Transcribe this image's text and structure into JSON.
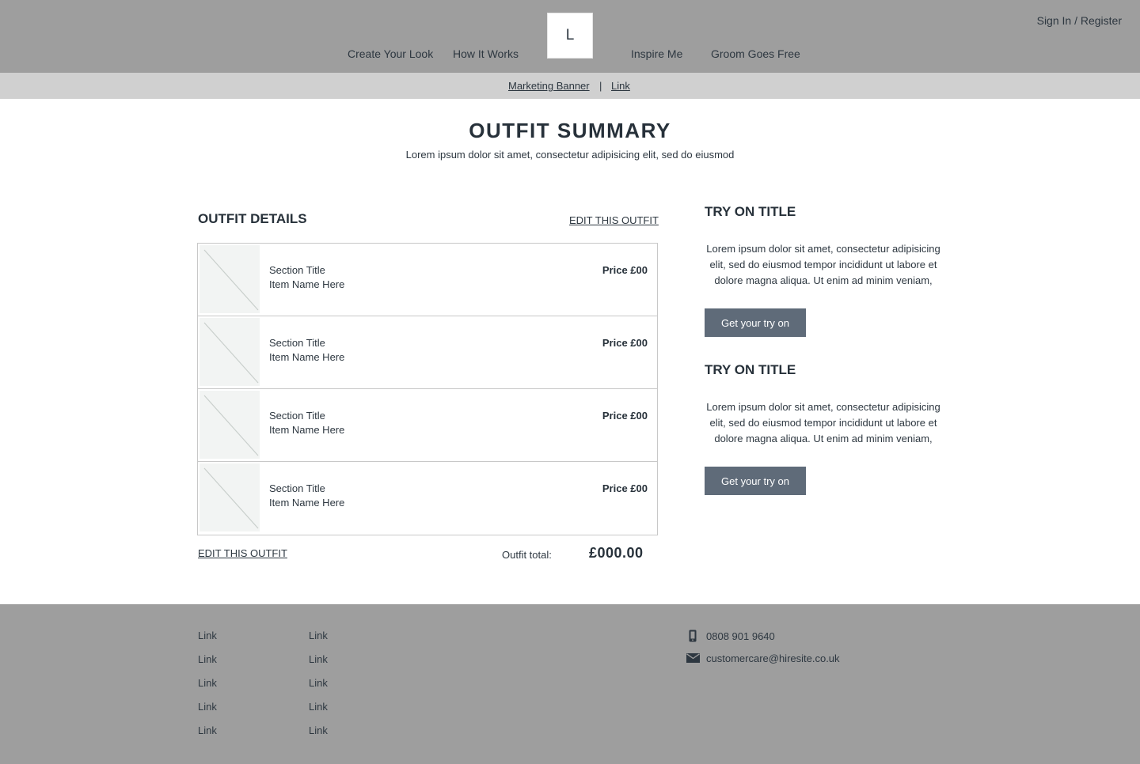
{
  "header": {
    "logo": "L",
    "nav": [
      "Create Your Look",
      "How It Works",
      "Inspire Me",
      "Groom Goes Free"
    ],
    "signin": "Sign In / Register"
  },
  "banner": {
    "text": "Marketing Banner",
    "separator": "|",
    "link": "Link"
  },
  "main": {
    "title": "OUTFIT SUMMARY",
    "subtitle": "Lorem ipsum dolor sit amet, consectetur adipisicing elit, sed do eiusmod"
  },
  "outfit": {
    "heading": "OUTFIT DETAILS",
    "edit_label": "EDIT THIS OUTFIT",
    "items": [
      {
        "section": "Section Title",
        "name": "Item Name Here",
        "price": "Price £00"
      },
      {
        "section": "Section Title",
        "name": "Item Name Here",
        "price": "Price £00"
      },
      {
        "section": "Section Title",
        "name": "Item Name Here",
        "price": "Price £00"
      },
      {
        "section": "Section Title",
        "name": "Item Name Here",
        "price": "Price £00"
      }
    ],
    "total_label": "Outfit total:",
    "total_value": "£000.00"
  },
  "tryon": [
    {
      "title": "TRY ON TITLE",
      "text": "Lorem ipsum dolor sit amet, consectetur adipisicing elit, sed do eiusmod tempor incididunt ut labore et dolore magna aliqua. Ut enim ad minim veniam,",
      "button": "Get your try on"
    },
    {
      "title": "TRY ON TITLE",
      "text": "Lorem ipsum dolor sit amet, consectetur adipisicing elit, sed do eiusmod tempor incididunt ut labore et dolore magna aliqua. Ut enim ad minim veniam,",
      "button": "Get your try on"
    }
  ],
  "footer": {
    "col1": [
      "Link",
      "Link",
      "Link",
      "Link",
      "Link"
    ],
    "col2": [
      "Link",
      "Link",
      "Link",
      "Link",
      "Link"
    ],
    "phone": "0808 901 9640",
    "email": "customercare@hiresite.co.uk"
  },
  "icons": {
    "phone": "phone-icon",
    "email": "envelope-icon"
  },
  "colors": {
    "header_bg": "#9e9e9e",
    "banner_bg": "#d0d0d0",
    "button_bg": "#5f6b79",
    "text": "#27313a"
  }
}
